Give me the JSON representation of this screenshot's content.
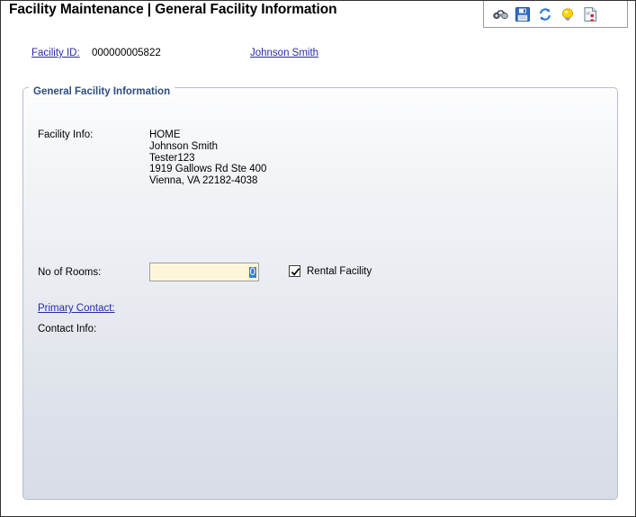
{
  "page": {
    "title": "Facility Maintenance | General Facility Information"
  },
  "toolbar": {
    "buttons": [
      {
        "name": "binoculars-icon",
        "label": "Search"
      },
      {
        "name": "save-icon",
        "label": "Save"
      },
      {
        "name": "refresh-icon",
        "label": "Refresh"
      },
      {
        "name": "lightbulb-icon",
        "label": "Hint"
      },
      {
        "name": "report-icon",
        "label": "Report"
      }
    ]
  },
  "identity": {
    "facility_id_label": "Facility ID:",
    "facility_id_value": "000000005822",
    "owner_name": "Johnson Smith"
  },
  "fieldset": {
    "legend": "General Facility Information"
  },
  "form": {
    "facility_info_label": "Facility Info:",
    "facility_info_value": "HOME\nJohnson Smith\nTester123\n1919 Gallows Rd Ste 400\nVienna, VA 22182-4038",
    "rooms_label": "No of Rooms:",
    "rooms_value": "0",
    "rental_label": "Rental Facility",
    "rental_checked": true,
    "primary_contact_label": "Primary Contact:",
    "contact_info_label": "Contact Info:"
  },
  "colors": {
    "link": "#2a2aa8",
    "legend": "#2b4d7e",
    "input_background": "#fcf7d7",
    "selection": "#2f7fe0",
    "panel_border": "#b9bec8"
  }
}
